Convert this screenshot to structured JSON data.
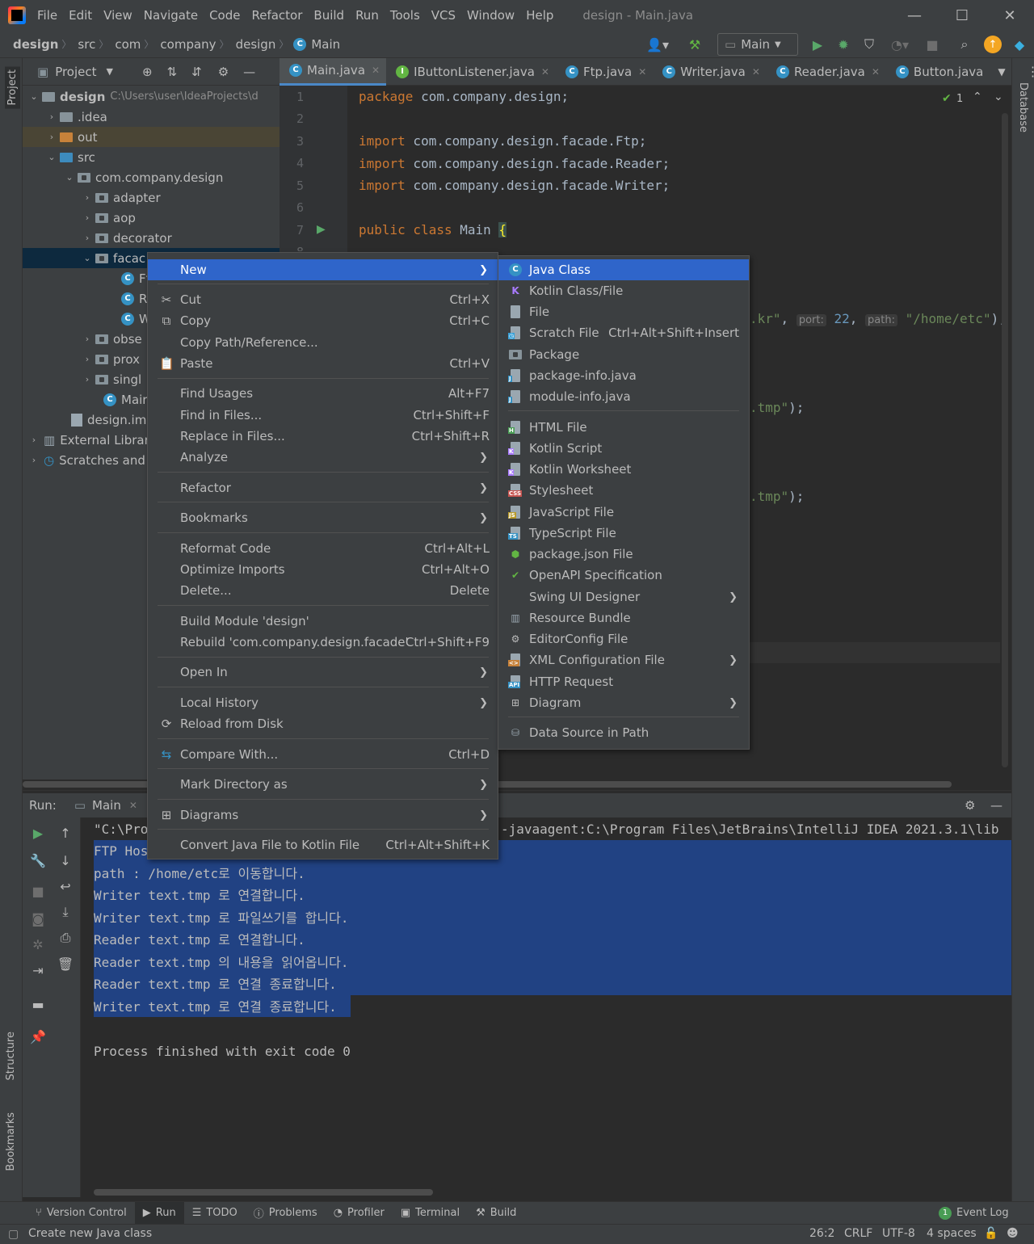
{
  "app": {
    "menu": [
      "File",
      "Edit",
      "View",
      "Navigate",
      "Code",
      "Refactor",
      "Build",
      "Run",
      "Tools",
      "VCS",
      "Window",
      "Help"
    ],
    "window_title": "design - Main.java"
  },
  "nav": {
    "breadcrumbs": [
      "design",
      "src",
      "com",
      "company",
      "design",
      "Main"
    ],
    "run_config": "Main"
  },
  "project": {
    "header": "Project",
    "tree": [
      {
        "label": "design",
        "path": "C:\\Users\\user\\IdeaProjects\\d"
      },
      {
        "label": ".idea"
      },
      {
        "label": "out"
      },
      {
        "label": "src"
      },
      {
        "label": "com.company.design"
      },
      {
        "label": "adapter"
      },
      {
        "label": "aop"
      },
      {
        "label": "decorator"
      },
      {
        "label": "facac"
      },
      {
        "label": "Ft"
      },
      {
        "label": "R"
      },
      {
        "label": "W"
      },
      {
        "label": "obse"
      },
      {
        "label": "prox"
      },
      {
        "label": "singl"
      },
      {
        "label": "Mair"
      },
      {
        "label": "design.iml"
      },
      {
        "label": "External Librari"
      },
      {
        "label": "Scratches and"
      }
    ]
  },
  "tabs": [
    "Main.java",
    "IButtonListener.java",
    "Ftp.java",
    "Writer.java",
    "Reader.java",
    "Button.java"
  ],
  "editor": {
    "inspection_count": "1",
    "line_numbers": [
      "1",
      "2",
      "3",
      "4",
      "5",
      "6",
      "7",
      "8"
    ],
    "lines": {
      "l1_kw": "package",
      "l1_rest": " com.company.design;",
      "l3_kw": "import",
      "l3_rest": " com.company.design.facade.Ftp;",
      "l4_kw": "import",
      "l4_rest": " com.company.design.facade.Reader;",
      "l5_kw": "import",
      "l5_rest": " com.company.design.facade.Writer;",
      "l7_kw": "public class",
      "l7_rest": " Main ",
      "l7_brace": "{"
    },
    "frag1_str": ".kr\"",
    "frag1_comma": ",",
    "hint_port": "port:",
    "port_val": "22",
    "frag1_comma2": ",",
    "hint_path": "path:",
    "path_val": "\"/home/etc\"",
    "frag1_end": ");",
    "frag2_str": ".tmp\"",
    "frag2_end": ");",
    "frag3_str": ".tmp\"",
    "frag3_end": ");"
  },
  "run": {
    "label": "Run:",
    "tab": "Main",
    "console": [
      "\"C:\\Pro",
      "FTP Hos",
      "path : /home/etc로 이동합니다.",
      "Writer text.tmp 로 연결합니다.",
      "Writer text.tmp 로 파일쓰기를 합니다.",
      "Reader text.tmp 로 연결합니다.",
      "Reader text.tmp 의 내용을 읽어옵니다.",
      "Reader text.tmp 로 연결 종료합니다.",
      "Writer text.tmp 로 연결 종료합니다.",
      "",
      "Process finished with exit code 0"
    ],
    "console_cont": "-javaagent:C:\\Program Files\\JetBrains\\IntelliJ IDEA 2021.3.1\\lib"
  },
  "context_menu": {
    "new": "New",
    "cut": "Cut",
    "cut_sc": "Ctrl+X",
    "copy": "Copy",
    "copy_sc": "Ctrl+C",
    "copy_path": "Copy Path/Reference...",
    "paste": "Paste",
    "paste_sc": "Ctrl+V",
    "find_usages": "Find Usages",
    "find_usages_sc": "Alt+F7",
    "find_in_files": "Find in Files...",
    "find_in_files_sc": "Ctrl+Shift+F",
    "replace_in_files": "Replace in Files...",
    "replace_in_files_sc": "Ctrl+Shift+R",
    "analyze": "Analyze",
    "refactor": "Refactor",
    "bookmarks": "Bookmarks",
    "reformat": "Reformat Code",
    "reformat_sc": "Ctrl+Alt+L",
    "optimize": "Optimize Imports",
    "optimize_sc": "Ctrl+Alt+O",
    "delete": "Delete...",
    "delete_sc": "Delete",
    "build_module": "Build Module 'design'",
    "rebuild": "Rebuild 'com.company.design.facade'",
    "rebuild_sc": "Ctrl+Shift+F9",
    "open_in": "Open In",
    "local_history": "Local History",
    "reload": "Reload from Disk",
    "compare": "Compare With...",
    "compare_sc": "Ctrl+D",
    "mark_dir": "Mark Directory as",
    "diagrams": "Diagrams",
    "convert": "Convert Java File to Kotlin File",
    "convert_sc": "Ctrl+Alt+Shift+K"
  },
  "new_submenu": {
    "java_class": "Java Class",
    "kotlin_class": "Kotlin Class/File",
    "file": "File",
    "scratch": "Scratch File",
    "scratch_sc": "Ctrl+Alt+Shift+Insert",
    "package": "Package",
    "package_info": "package-info.java",
    "module_info": "module-info.java",
    "html": "HTML File",
    "kotlin_script": "Kotlin Script",
    "kotlin_worksheet": "Kotlin Worksheet",
    "stylesheet": "Stylesheet",
    "javascript": "JavaScript File",
    "typescript": "TypeScript File",
    "package_json": "package.json File",
    "openapi": "OpenAPI Specification",
    "swing": "Swing UI Designer",
    "resource_bundle": "Resource Bundle",
    "editorconfig": "EditorConfig File",
    "xml_config": "XML Configuration File",
    "http_request": "HTTP Request",
    "diagram": "Diagram",
    "data_source": "Data Source in Path"
  },
  "side": {
    "left_project": "Project",
    "left_structure": "Structure",
    "left_bookmarks": "Bookmarks",
    "right_database": "Database"
  },
  "status": {
    "tool_tabs": [
      "Version Control",
      "Run",
      "TODO",
      "Problems",
      "Profiler",
      "Terminal",
      "Build"
    ],
    "event_log": "Event Log",
    "event_count": "1",
    "message": "Create new Java class",
    "position": "26:2",
    "line_sep": "CRLF",
    "encoding": "UTF-8",
    "indent": "4 spaces"
  }
}
